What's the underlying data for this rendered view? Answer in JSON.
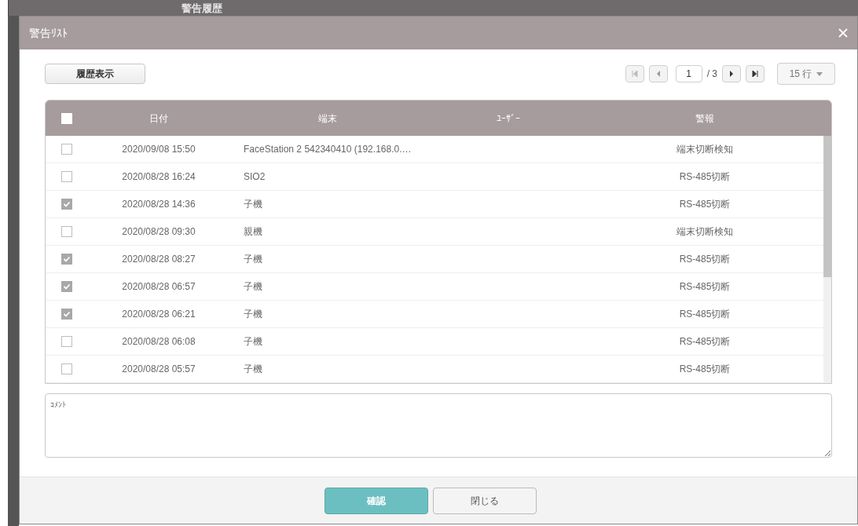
{
  "background_title": "警告履歴",
  "dialog": {
    "title": "警告ﾘｽﾄ"
  },
  "history_button": "履歴表示",
  "pager": {
    "page": "1",
    "total": "/ 3",
    "rows_per_page": "15 行"
  },
  "table": {
    "columns": [
      "日付",
      "端末",
      "ﾕｰｻﾞｰ",
      "警報"
    ],
    "all_checked": false,
    "rows": [
      {
        "checked": false,
        "date": "2020/09/08 15:50",
        "terminal": "FaceStation 2 542340410 (192.168.0.…",
        "alert": "端末切断検知"
      },
      {
        "checked": false,
        "date": "2020/08/28 16:24",
        "terminal": "SIO2",
        "alert": "RS-485切断"
      },
      {
        "checked": true,
        "date": "2020/08/28 14:36",
        "terminal": "子機",
        "alert": "RS-485切断"
      },
      {
        "checked": false,
        "date": "2020/08/28 09:30",
        "terminal": "親機",
        "alert": "端末切断検知"
      },
      {
        "checked": true,
        "date": "2020/08/28 08:27",
        "terminal": "子機",
        "alert": "RS-485切断"
      },
      {
        "checked": true,
        "date": "2020/08/28 06:57",
        "terminal": "子機",
        "alert": "RS-485切断"
      },
      {
        "checked": true,
        "date": "2020/08/28 06:21",
        "terminal": "子機",
        "alert": "RS-485切断"
      },
      {
        "checked": false,
        "date": "2020/08/28 06:08",
        "terminal": "子機",
        "alert": "RS-485切断"
      },
      {
        "checked": false,
        "date": "2020/08/28 05:57",
        "terminal": "子機",
        "alert": "RS-485切断"
      }
    ]
  },
  "comment": {
    "placeholder": "ｺﾒﾝﾄ"
  },
  "buttons": {
    "confirm": "確認",
    "close": "閉じる"
  }
}
